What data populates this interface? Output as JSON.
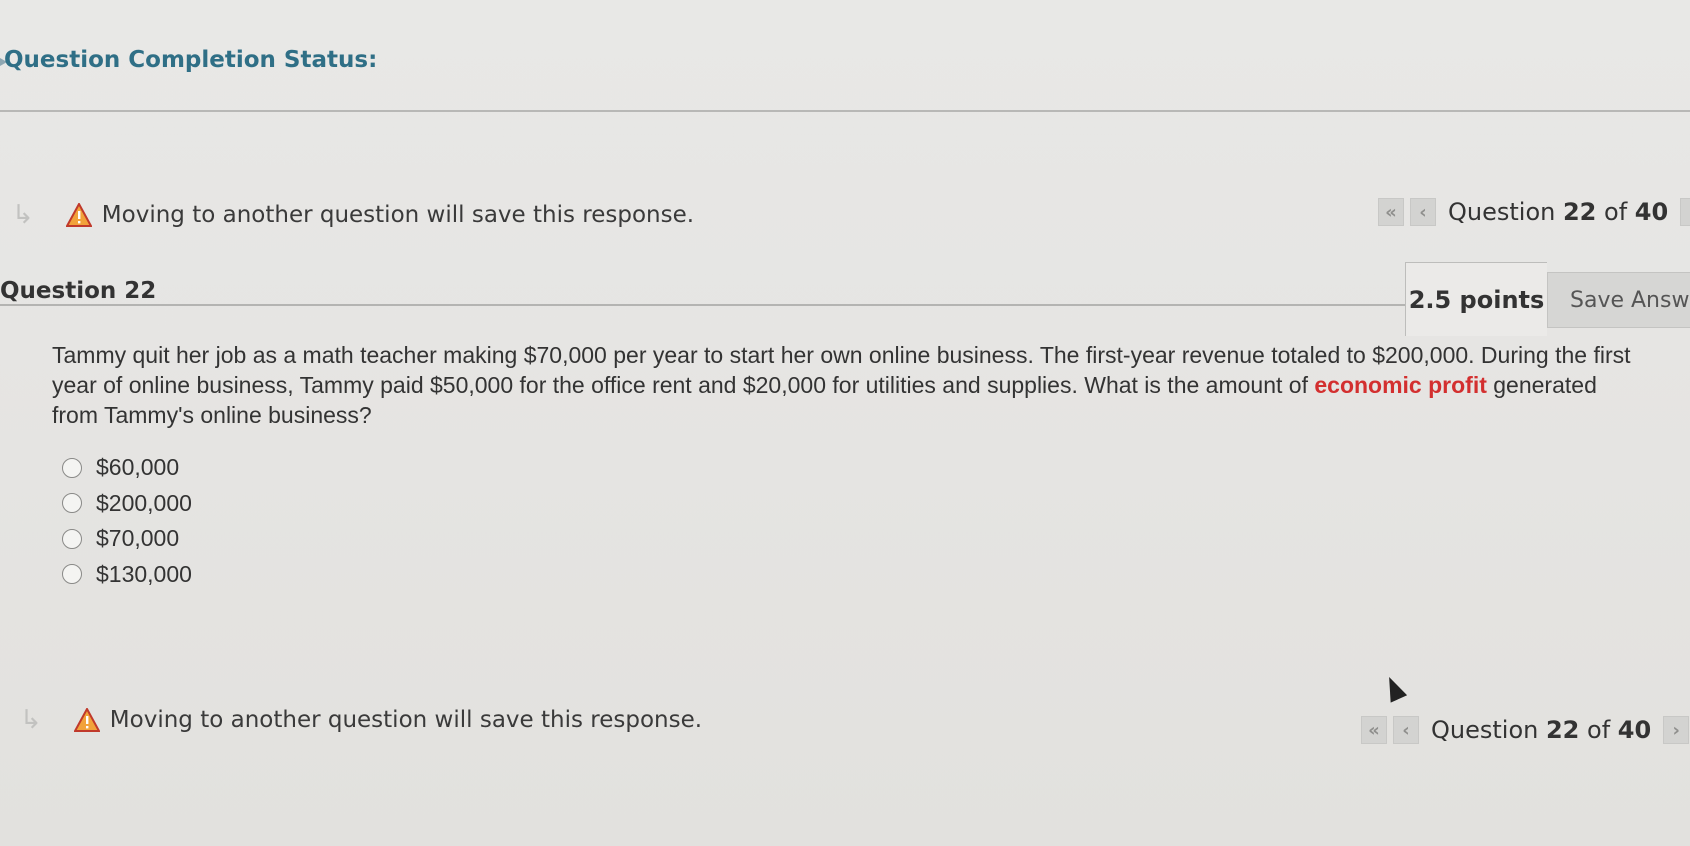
{
  "status": {
    "title": "Question Completion Status:"
  },
  "notice": {
    "text": "Moving to another question will save this response."
  },
  "nav": {
    "prefix": "Question ",
    "current": "22",
    "middle": " of ",
    "total": "40",
    "first_icon": "«",
    "prev_icon": "‹",
    "next_icon": "›",
    "last_icon": "»"
  },
  "question": {
    "heading": "Question 22",
    "points": "2.5 points",
    "save_label": "Save Answer",
    "text_before": "Tammy quit her job as a math teacher making $70,000 per year to start her own online business. The first-year revenue totaled to $200,000. During the first year of online business, Tammy paid $50,000 for the office rent and $20,000 for utilities and supplies. What is the amount of ",
    "highlight": "economic profit",
    "text_after": " generated from Tammy's online business?",
    "options": [
      "$60,000",
      "$200,000",
      "$70,000",
      "$130,000"
    ]
  },
  "colors": {
    "highlight": "#d32f2f",
    "status_title": "#2f6f86"
  }
}
